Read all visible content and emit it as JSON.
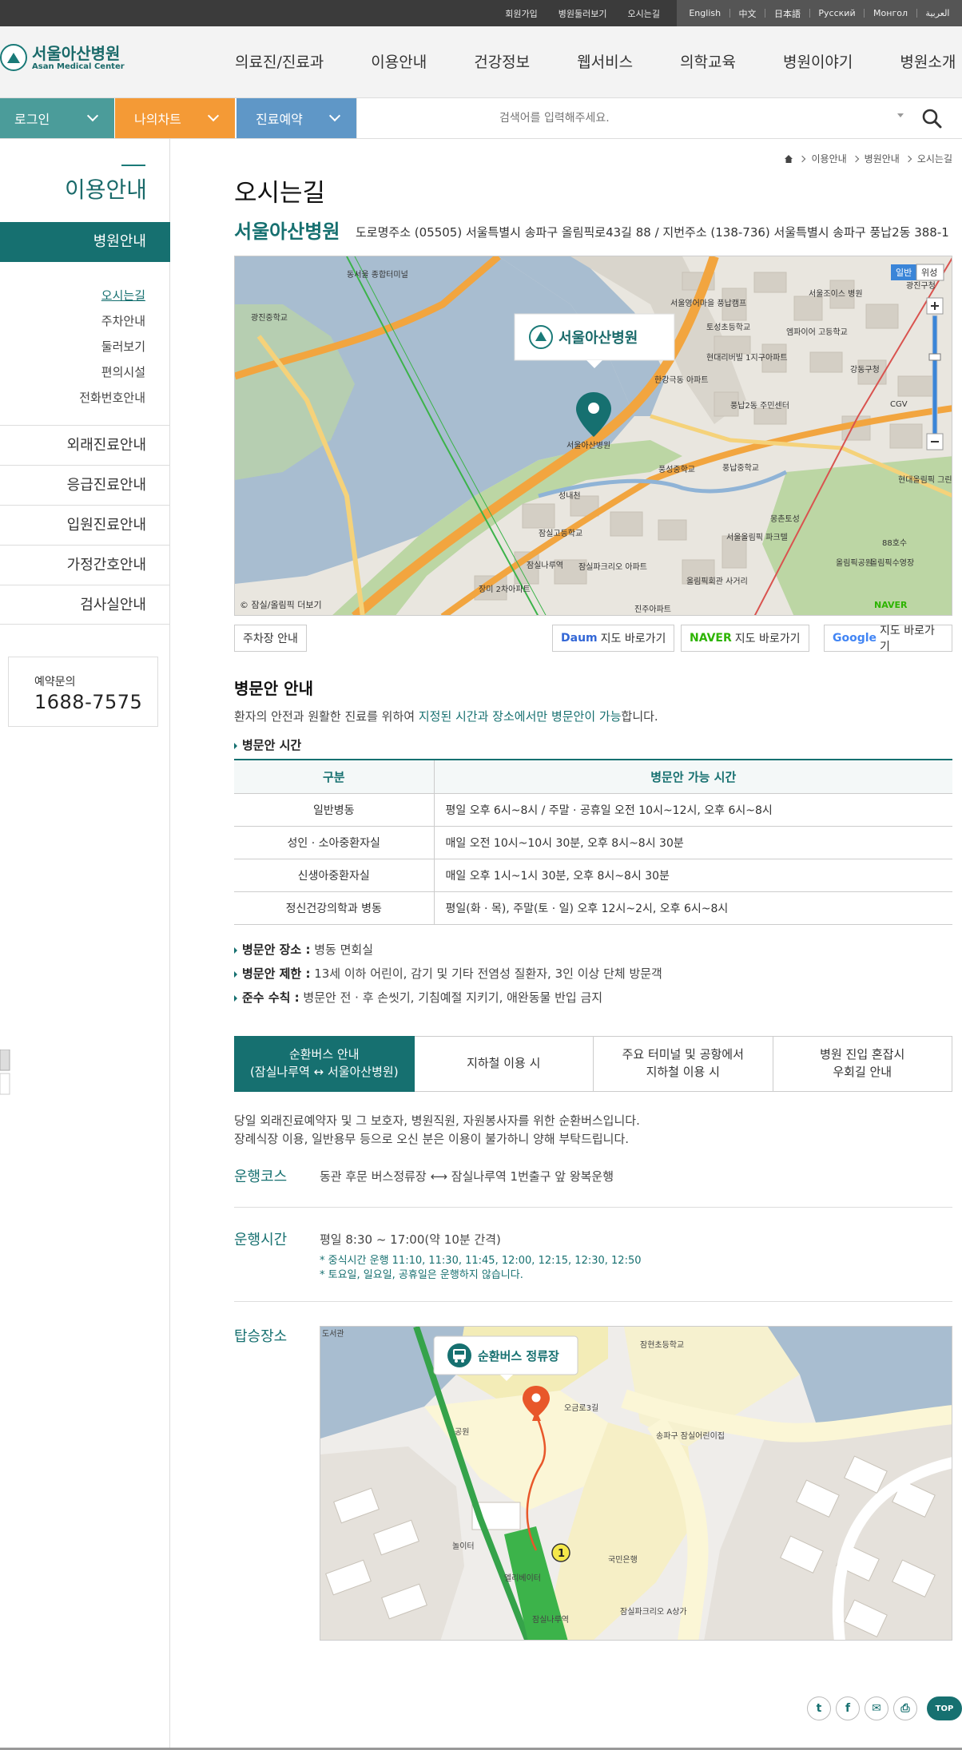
{
  "util": {
    "links": [
      "회원가입",
      "병원둘러보기",
      "오시는길"
    ],
    "langs": [
      "English",
      "中文",
      "日本語",
      "Русский",
      "Монгол",
      "العربية"
    ]
  },
  "header": {
    "logo_ko": "서울아산병원",
    "logo_en": "Asan Medical Center",
    "gnb": [
      "의료진/진료과",
      "이용안내",
      "건강정보",
      "웹서비스",
      "의학교육",
      "병원이야기",
      "병원소개"
    ]
  },
  "quick": {
    "login": "로그인",
    "mychart": "나의차트",
    "booking": "진료예약",
    "search_placeholder": "검색어를 입력해주세요.",
    "colors": {
      "login": "#4b9c9a",
      "mychart": "#f49a36",
      "booking": "#5f97c7"
    }
  },
  "sidebar": {
    "title": "이용안내",
    "active": "병원안내",
    "sub": [
      "오시는길",
      "주차안내",
      "둘러보기",
      "편의시설",
      "전화번호안내"
    ],
    "menu": [
      "외래진료안내",
      "응급진료안내",
      "입원진료안내",
      "가정간호안내",
      "검사실안내"
    ],
    "resv_label": "예약문의",
    "resv_number": "1688-7575"
  },
  "breadcrumb": [
    "이용안내",
    "병원안내",
    "오시는길"
  ],
  "page_title": "오시는길",
  "hospital": {
    "name": "서울아산병원",
    "address": "도로명주소 (05505) 서울특별시 송파구 올림픽로43길 88 / 지번주소 (138-736) 서울특별시 송파구 풍납2동 388-1"
  },
  "map": {
    "marker_label": "서울아산병원",
    "type_normal": "일반",
    "type_satellite": "위성",
    "copyright": "© 잠실/올림픽 더보기",
    "labels": [
      "동서울 종합터미널",
      "광진중학교",
      "서울영어마을 풍납캠프",
      "토성초등학교",
      "서울조이스 병원",
      "강동구청",
      "현대리버빌 1지구아파트",
      "엠파이어 고등학교",
      "한강극동 아파트",
      "풍납2동 주민센터",
      "서울아산병원",
      "풍성중학교",
      "풍납중학교",
      "성내천",
      "잠실고등학교",
      "몽촌토성",
      "서울올림픽 파크텔",
      "잠실나루역",
      "잠실파크리오 아파트",
      "올림픽회관 사거리",
      "장미 2차아파트",
      "진주아파트",
      "올림픽공원",
      "88호수",
      "CGV",
      "현대올림픽 그린타운",
      "올림픽수영장",
      "광진구청"
    ]
  },
  "map_buttons": {
    "parking": "주차장 안내",
    "daum_brand": "Daum",
    "naver_brand": "NAVER",
    "google_brand": "Google",
    "goto": "지도 바로가기"
  },
  "visit": {
    "title": "병문안 안내",
    "desc_pre": "환자의 안전과 원활한 진료를 위하여 ",
    "desc_hl": "지정된 시간과 장소에서만 병문안이 가능",
    "desc_post": "합니다.",
    "time_heading": "병문안 시간",
    "table_head": [
      "구분",
      "병문안 가능 시간"
    ],
    "table_rows": [
      [
        "일반병동",
        "평일 오후 6시~8시 / 주말 · 공휴일 오전 10시~12시, 오후 6시~8시"
      ],
      [
        "성인 · 소아중환자실",
        "매일 오전 10시~10시 30분, 오후 8시~8시 30분"
      ],
      [
        "신생아중환자실",
        "매일 오후 1시~1시 30분, 오후 8시~8시 30분"
      ],
      [
        "정신건강의학과 병동",
        "평일(화 · 목), 주말(토 · 일) 오후 12시~2시, 오후 6시~8시"
      ]
    ],
    "notes": [
      {
        "k": "병문안 장소 :",
        "v": " 병동 면회실"
      },
      {
        "k": "병문안 제한 :",
        "v": " 13세 이하 어린이, 감기 및 기타 전염성 질환자, 3인 이상 단체 방문객"
      },
      {
        "k": "준수 수칙 :",
        "v": " 병문안 전 · 후 손씻기, 기침예절 지키기, 애완동물 반입 금지"
      }
    ]
  },
  "tabs": [
    "순환버스 안내\n(잠실나루역 ↔ 서울아산병원)",
    "지하철 이용 시",
    "주요 터미널 및 공항에서\n지하철 이용 시",
    "병원 진입 혼잡시\n우회길 안내"
  ],
  "bus": {
    "desc1": "당일 외래진료예약자 및 그 보호자, 병원직원, 자원봉사자를 위한 순환버스입니다.",
    "desc2": "장례식장 이용, 일반용무 등으로 오신 분은 이용이 불가하니 양해 부탁드립니다.",
    "course_label": "운행코스",
    "course_text": "동관 후문 버스정류장 ⟷ 잠실나루역 1번출구 앞 왕복운행",
    "time_label": "운행시간",
    "time_text": "평일 8:30 ~ 17:00(약 10분 간격)",
    "time_note1": "* 중식시간 운행 11:10, 11:30, 11:45, 12:00, 12:15, 12:30, 12:50",
    "time_note2": "* 토요일, 일요일, 공휴일은 운행하지 않습니다.",
    "stop_label": "탑승장소",
    "stop_badge": "순환버스 정류장",
    "stop_map_labels": [
      "잠현초등학교",
      "송파구 잠실어린이집",
      "국민은행",
      "잠실파크리오 A상가",
      "엘리베이터",
      "놀이터",
      "잠실나루역",
      "공원",
      "도서관",
      "오금로3길"
    ]
  },
  "share": {
    "top": "TOP"
  }
}
